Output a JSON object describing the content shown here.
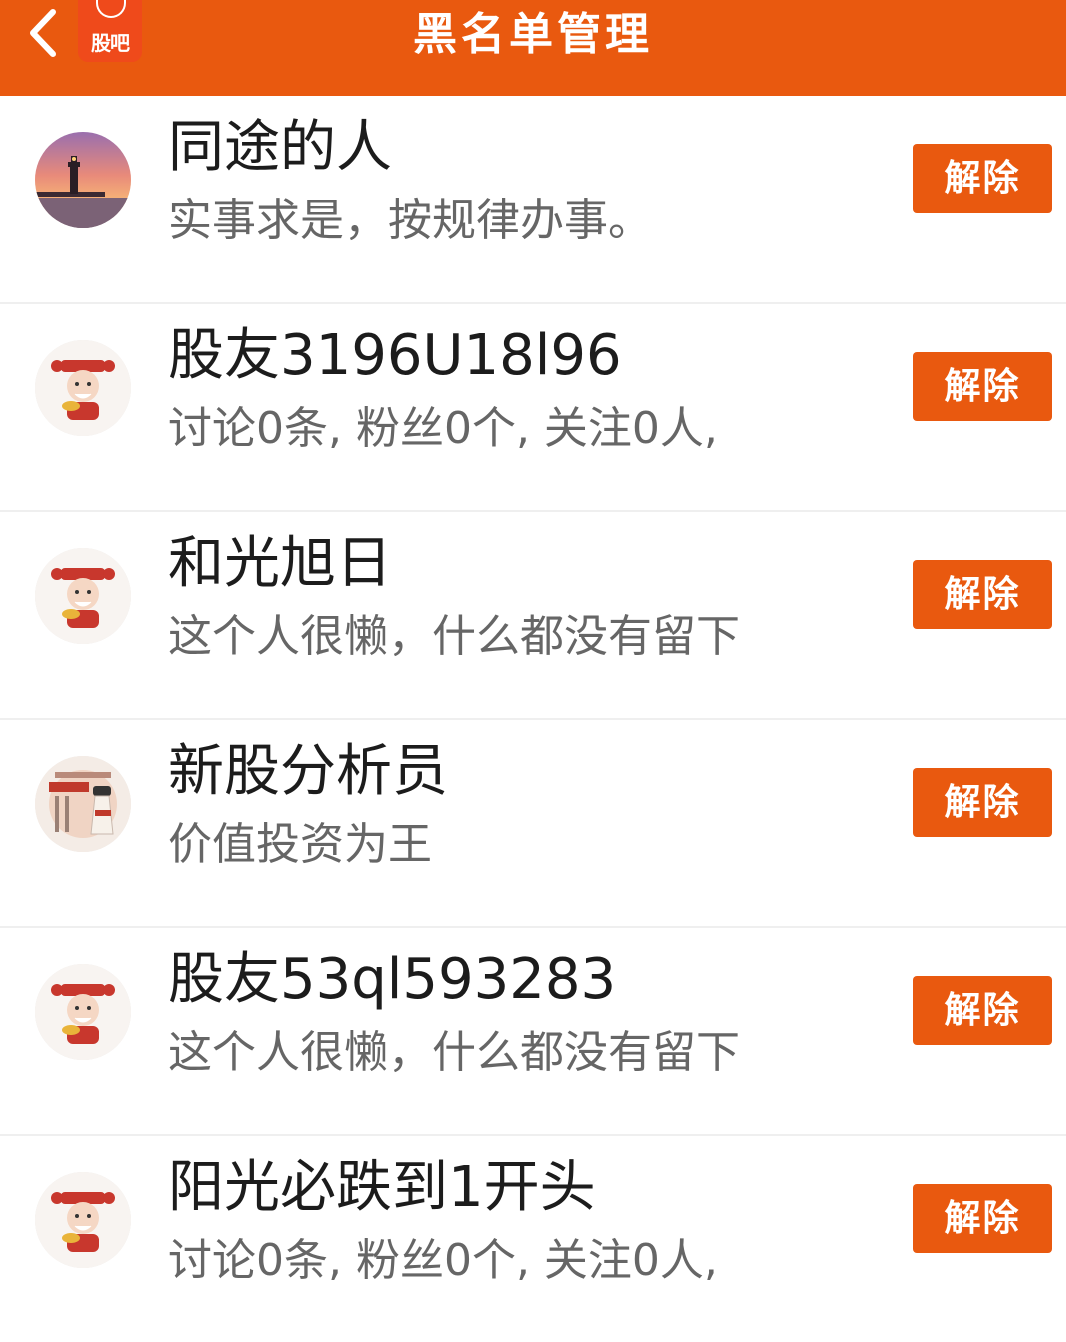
{
  "header": {
    "title": "黑名单管理",
    "logo_text": "股吧",
    "back_icon": "chevron-left-icon",
    "accent_color": "#e9590f"
  },
  "users": [
    {
      "name": "同途的人",
      "desc": "实事求是，按规律办事。",
      "avatar": "lighthouse-sunset",
      "button": "解除"
    },
    {
      "name": "股友3196U18l96",
      "desc": "讨论0条, 粉丝0个, 关注0人,",
      "avatar": "caishen-default",
      "button": "解除"
    },
    {
      "name": "和光旭日",
      "desc": "这个人很懒，什么都没有留下",
      "avatar": "caishen-default",
      "button": "解除"
    },
    {
      "name": "新股分析员",
      "desc": "价值投资为王",
      "avatar": "poster-figure",
      "button": "解除"
    },
    {
      "name": "股友53ql593283",
      "desc": "这个人很懒，什么都没有留下",
      "avatar": "caishen-default",
      "button": "解除"
    },
    {
      "name": "阳光必跌到1开头",
      "desc": "讨论0条, 粉丝0个, 关注0人,",
      "avatar": "caishen-default",
      "button": "解除"
    }
  ]
}
